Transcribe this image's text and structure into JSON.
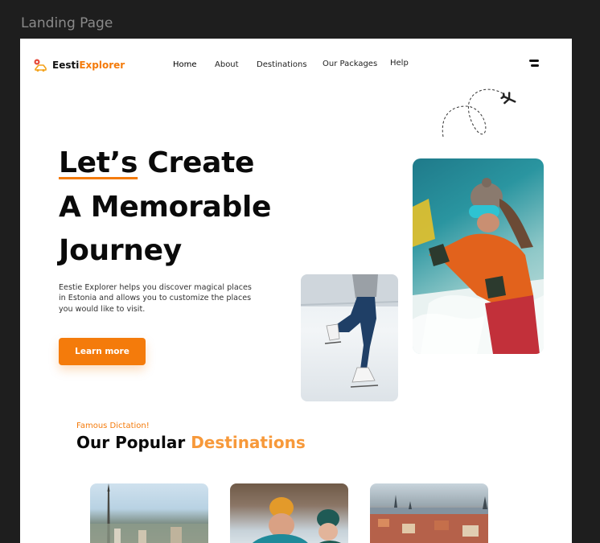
{
  "frame_label": "Landing Page",
  "logo": {
    "part1": "Eesti",
    "part2": "Explorer"
  },
  "nav": {
    "items": [
      {
        "label": "Home"
      },
      {
        "label": "About"
      },
      {
        "label": "Destinations"
      },
      {
        "label": "Our Packages"
      },
      {
        "label": "Help"
      }
    ]
  },
  "hero": {
    "title_underlined": "Let’s",
    "title_line1_rest": " Create",
    "title_line2": "A Memorable",
    "title_line3": "Journey",
    "description": "Eestie Explorer helps you discover magical places in Estonia and allows you to customize the places you would like to visit.",
    "cta_label": "Learn more"
  },
  "popular": {
    "eyebrow": "Famous Dictation!",
    "title_main": "Our Popular ",
    "title_accent": "Destinations"
  },
  "colors": {
    "accent": "#f47b0b",
    "accent_light": "#f7993a",
    "frame_bg": "#1e1e1e"
  },
  "icons": {
    "menu": "menu-icon",
    "plane": "airplane-icon",
    "logo": "location-pin-car-icon"
  }
}
